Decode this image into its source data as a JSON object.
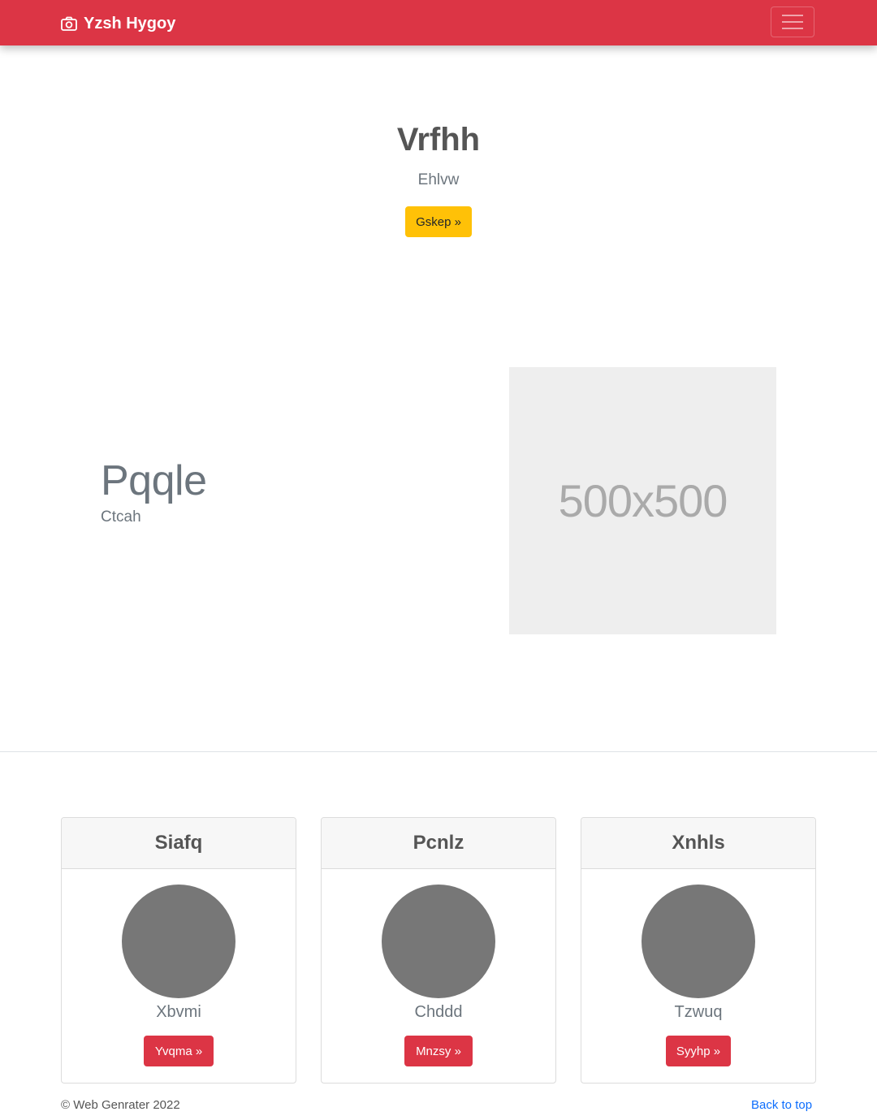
{
  "navbar": {
    "brand": "Yzsh Hygoy",
    "brand_icon": "camera-icon",
    "toggler_icon": "hamburger-menu-icon",
    "color": "#dc3545"
  },
  "hero": {
    "title": "Vrfhh",
    "subtitle": "Ehlvw",
    "button": "Gskep »",
    "button_color": "#ffc107"
  },
  "feature": {
    "title": "Pqqle",
    "subtitle": "Ctcah",
    "image_text": "500x500"
  },
  "cards": [
    {
      "title": "Siafq",
      "text": "Xbvmi",
      "button": "Yvqma »"
    },
    {
      "title": "Pcnlz",
      "text": "Chddd",
      "button": "Mnzsy »"
    },
    {
      "title": "Xnhls",
      "text": "Tzwuq",
      "button": "Syyhp »"
    }
  ],
  "footer": {
    "copyright": "© Web Genrater 2022",
    "back_to_top": "Back to top"
  }
}
